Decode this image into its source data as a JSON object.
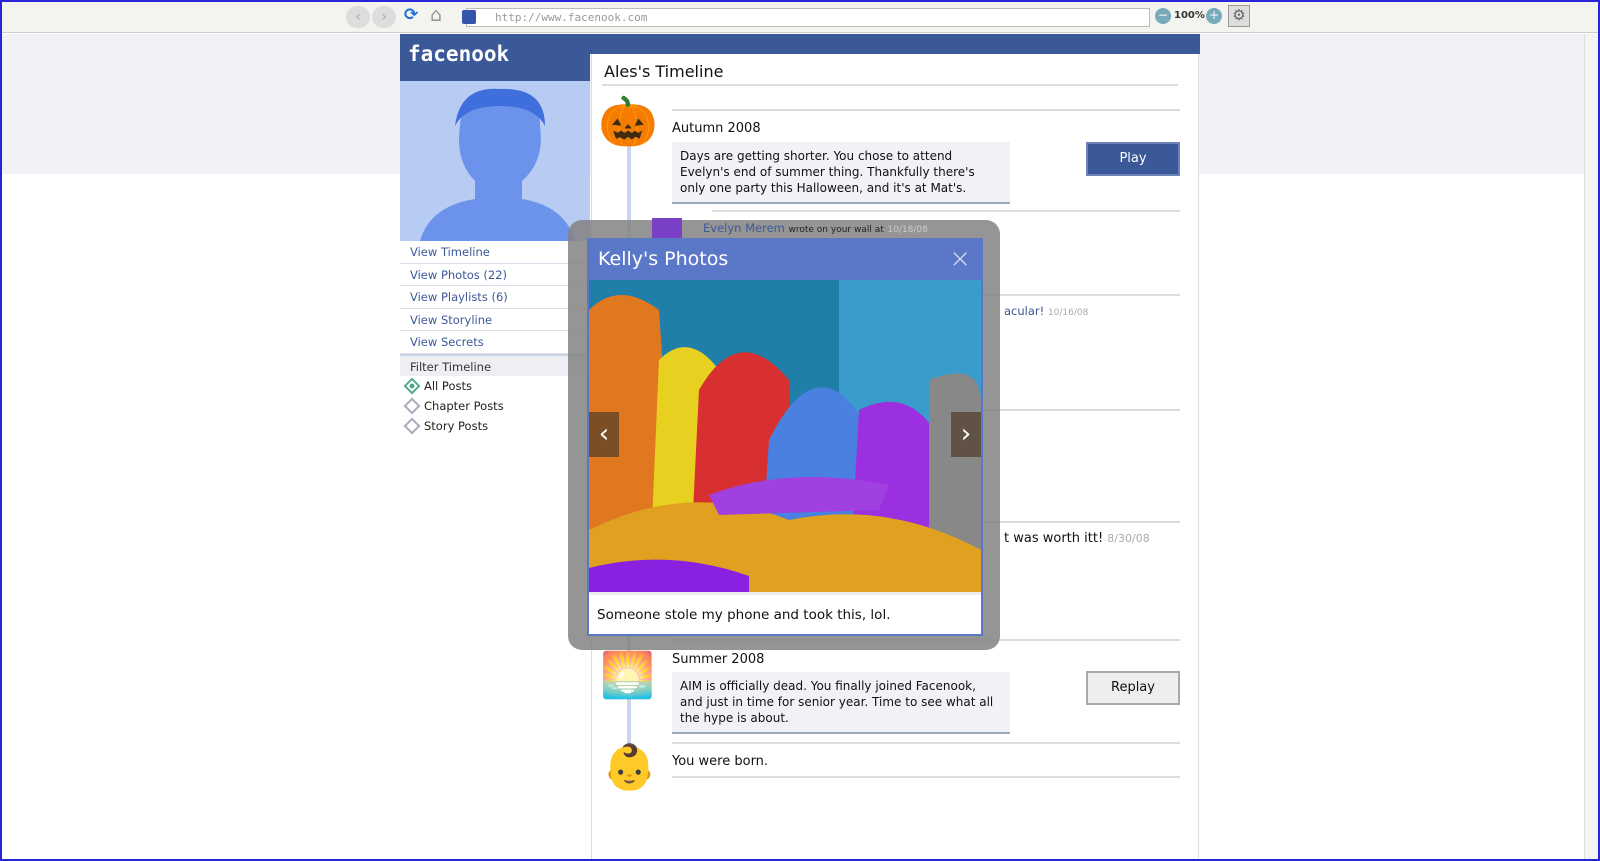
{
  "browser": {
    "url": "http://www.facenook.com",
    "zoom": "100%",
    "back": "‹",
    "forward": "›",
    "reload": "⟳",
    "home": "⌂",
    "zoom_out": "−",
    "zoom_in": "+",
    "settings": "⚙"
  },
  "site": {
    "logo": "facenook"
  },
  "sidebar": {
    "links": [
      "View Timeline",
      "View Photos (22)",
      "View Playlists (6)",
      "View Storyline",
      "View Secrets"
    ],
    "filter_label": "Filter Timeline",
    "filters": [
      {
        "label": "All Posts",
        "selected": true
      },
      {
        "label": "Chapter Posts",
        "selected": false
      },
      {
        "label": "Story Posts",
        "selected": false
      }
    ]
  },
  "timeline": {
    "title": "Ales's Timeline",
    "autumn": {
      "heading": "Autumn 2008",
      "body": "Days are getting shorter. You chose to attend Evelyn's end of summer thing. Thankfully there's only one party this Halloween, and it's at Mat's.",
      "button": "Play"
    },
    "wall": {
      "author": "Evelyn Merem",
      "action": "wrote on your wall at",
      "date": "10/18/08"
    },
    "partial1": {
      "text": "acular!",
      "date": "10/16/08"
    },
    "partial2": {
      "text": "t was worth itt!",
      "date": "8/30/08"
    },
    "summer": {
      "heading": "Summer 2008",
      "body": "AIM is officially dead. You finally joined Facenook, and just in time for senior year. Time to see what all the hype is about.",
      "button": "Replay"
    },
    "born": {
      "text": "You were born."
    }
  },
  "modal": {
    "title": "Kelly's Photos",
    "close": "×",
    "prev": "‹",
    "next": "›",
    "caption": "Someone stole my phone and took this, lol."
  }
}
